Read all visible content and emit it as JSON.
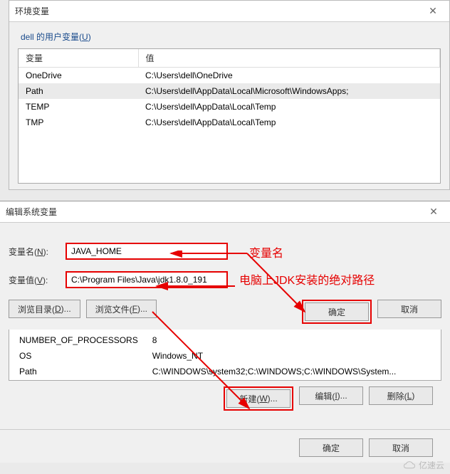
{
  "window1": {
    "title": "环境变量",
    "section_label_pre": "dell 的用户变量(",
    "section_label_key": "U",
    "section_label_post": ")",
    "headers": {
      "var": "变量",
      "val": "值"
    },
    "rows": [
      {
        "var": "OneDrive",
        "val": "C:\\Users\\dell\\OneDrive"
      },
      {
        "var": "Path",
        "val": "C:\\Users\\dell\\AppData\\Local\\Microsoft\\WindowsApps;"
      },
      {
        "var": "TEMP",
        "val": "C:\\Users\\dell\\AppData\\Local\\Temp"
      },
      {
        "var": "TMP",
        "val": "C:\\Users\\dell\\AppData\\Local\\Temp"
      }
    ]
  },
  "window2": {
    "title": "编辑系统变量",
    "name_label_pre": "变量名(",
    "name_label_key": "N",
    "name_label_post": "):",
    "name_value": "JAVA_HOME",
    "val_label_pre": "变量值(",
    "val_label_key": "V",
    "val_label_post": "):",
    "val_value": "C:\\Program Files\\Java\\jdk1.8.0_191",
    "browse_dir_pre": "浏览目录(",
    "browse_dir_key": "D",
    "browse_dir_post": ")...",
    "browse_file_pre": "浏览文件(",
    "browse_file_key": "F",
    "browse_file_post": ")...",
    "ok": "确定",
    "cancel": "取消"
  },
  "annotations": {
    "name": "变量名",
    "path": "电脑上JDK安装的绝对路径"
  },
  "systable": {
    "rows": [
      {
        "var": "NUMBER_OF_PROCESSORS",
        "val": "8"
      },
      {
        "var": "OS",
        "val": "Windows_NT"
      },
      {
        "var": "Path",
        "val": "C:\\WINDOWS\\system32;C:\\WINDOWS;C:\\WINDOWS\\System..."
      }
    ],
    "new_pre": "新建(",
    "new_key": "W",
    "new_post": ")...",
    "edit_pre": "编辑(",
    "edit_key": "I",
    "edit_post": ")...",
    "del_pre": "删除(",
    "del_key": "L",
    "del_post": ")"
  },
  "footer": {
    "ok": "确定",
    "cancel": "取消"
  },
  "watermark": "亿速云"
}
